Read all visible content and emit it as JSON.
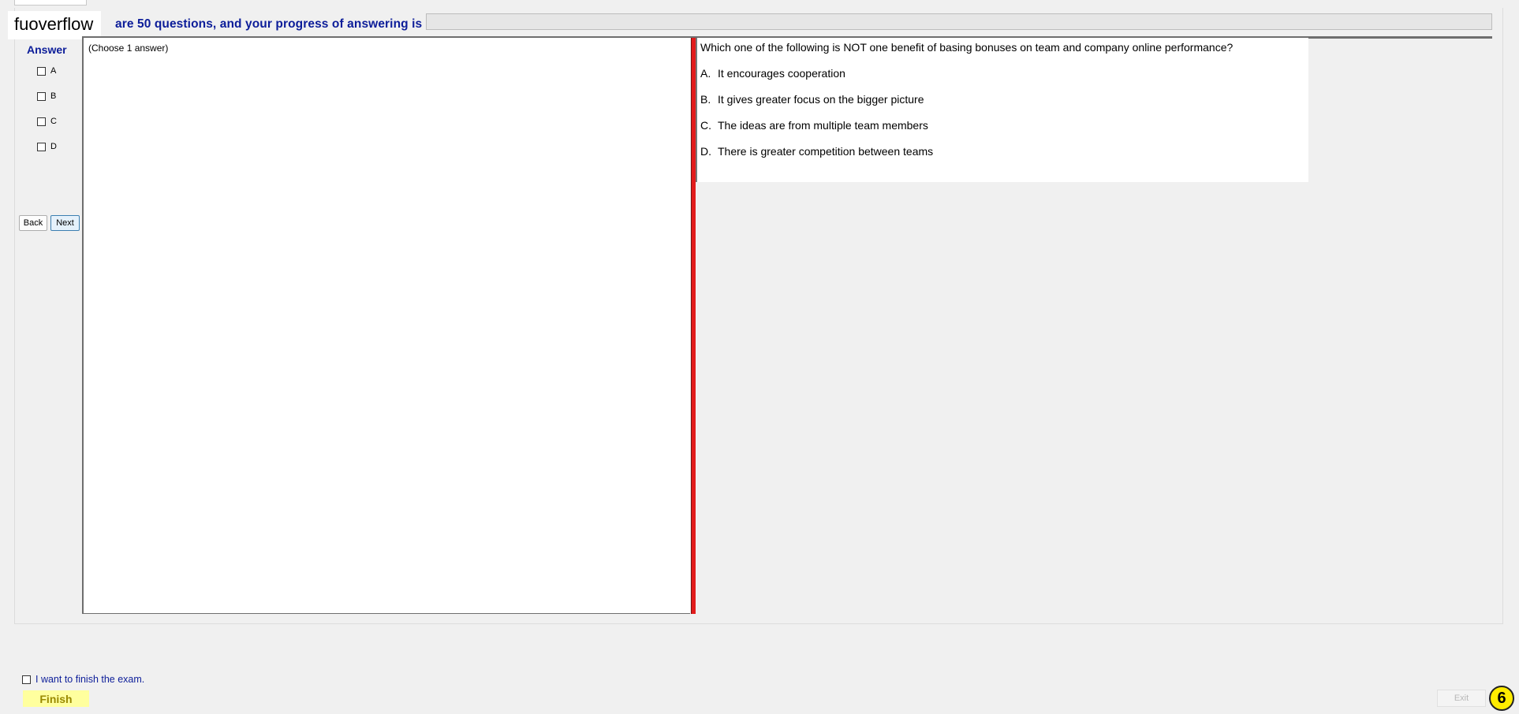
{
  "header": {
    "brand": "fuoverflow",
    "status_text": "are 50 questions, and your progress of answering is",
    "progress_value": 0
  },
  "answer_panel": {
    "heading": "Answer",
    "options": [
      "A",
      "B",
      "C",
      "D"
    ],
    "back_label": "Back",
    "next_label": "Next"
  },
  "left_pane": {
    "instruction": "(Choose 1 answer)"
  },
  "question": {
    "text": "Which one of the following is NOT one benefit of basing bonuses on team and company online performance?",
    "options": [
      {
        "letter": "A.",
        "text": "It encourages cooperation"
      },
      {
        "letter": "B.",
        "text": "It gives greater focus on the bigger picture"
      },
      {
        "letter": "C.",
        "text": "The ideas are from multiple team members"
      },
      {
        "letter": "D.",
        "text": "There is greater competition between teams"
      }
    ]
  },
  "footer": {
    "finish_check_label": "I want to finish the exam.",
    "finish_label": "Finish",
    "exit_label": "Exit",
    "badge_number": "6"
  },
  "colors": {
    "accent_blue": "#0c1d99",
    "divider_red": "#e21c1c",
    "finish_yellow": "#ffff9e",
    "badge_yellow": "#ffec00"
  }
}
